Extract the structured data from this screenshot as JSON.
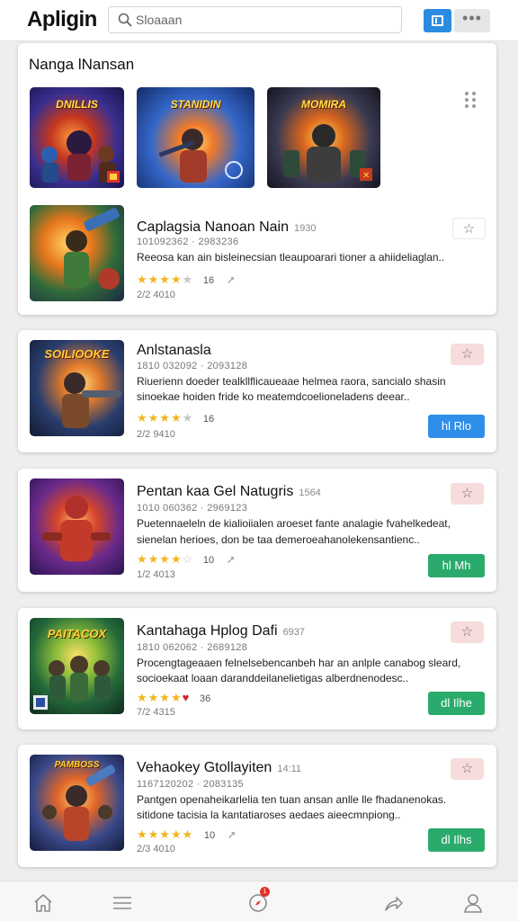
{
  "header": {
    "app_title": "Apligin",
    "search_placeholder": "Sloaaan"
  },
  "featured": {
    "title": "Nanga lNansan",
    "thumbs": [
      {
        "caption": "DNILLIS"
      },
      {
        "caption": "STANIDIN"
      },
      {
        "caption": "MOMIRA"
      }
    ],
    "item": {
      "title": "Caplagsia Nanoan Nain",
      "meta": "1930",
      "line": "101092362 · 2983236",
      "desc": "Reeosa kan ain bisleinecsian tleaupoarari tioner a ahiideliaglan..",
      "rating": 4,
      "count": "16",
      "date": "2/2 4010"
    }
  },
  "items": [
    {
      "title": "Anlstanasla",
      "meta": "",
      "line": "1810 032092 · 2093128",
      "desc1": "Riuerienn doeder tealkllflicaueaae helmea raora, sancialo shasin",
      "desc2": "sinoekae hoiden fride ko meatemdcoelioneladens deear..",
      "rating": 4,
      "count": "16",
      "date": "2/2 9410",
      "button": "hl Rlo",
      "button_color": "#2f8fe8",
      "fav_style": "pink"
    },
    {
      "title": "Pentan kaa Gel Natugris",
      "meta": "1564",
      "line": "1010 060362 · 2969123",
      "desc1": "Puetennaeleln de kialioiialen aroeset fante analagie fvahelkedeat,",
      "desc2": "sienelan herioes, don be taa demeroeahanolekensantienc..",
      "rating": 4,
      "count": "10",
      "date": "1/2 4013",
      "button": "hl Mh",
      "button_color": "#2aab6c",
      "fav_style": "pink"
    },
    {
      "title": "Kantahaga Hplog Dafi",
      "meta": "6937",
      "line": "1810 062062 · 2689128",
      "desc1": "Procengtageaaen felnelsebencanbeh har an anlple canabog sleard,",
      "desc2": "socioekaat loaan daranddeilanelietigas alberdnenodesc..",
      "rating": 4,
      "heart": true,
      "count": "36",
      "date": "7/2 4315",
      "button": "dl Ilhe",
      "button_color": "#2aab6c",
      "fav_style": "pink"
    },
    {
      "title": "Vehaokey Gtollayiten",
      "meta": "14:11",
      "line": "1167120202 · 2083135",
      "desc1": "Pantgen openaheikarlelia ten tuan ansan anlle lle fhadanenokas.",
      "desc2": "sitidone tacisia la kantatiaroses aedaes aieecmnpiong..",
      "rating": 5,
      "count": "10",
      "date": "2/3 4010",
      "button": "dl Ilhs",
      "button_color": "#2aab6c",
      "fav_style": "pink"
    }
  ],
  "thumb_captions": [
    "SOILIOOKE",
    "PAITACOX",
    "PAMBOSS"
  ],
  "bottom_nav": {
    "badge": "1",
    "items": [
      "home-icon",
      "menu-icon",
      "compass-icon",
      "share-icon",
      "profile-icon"
    ]
  },
  "colors": {
    "accent_blue": "#2b8be0",
    "button_green": "#2aab6c",
    "star": "#f2b51c"
  }
}
